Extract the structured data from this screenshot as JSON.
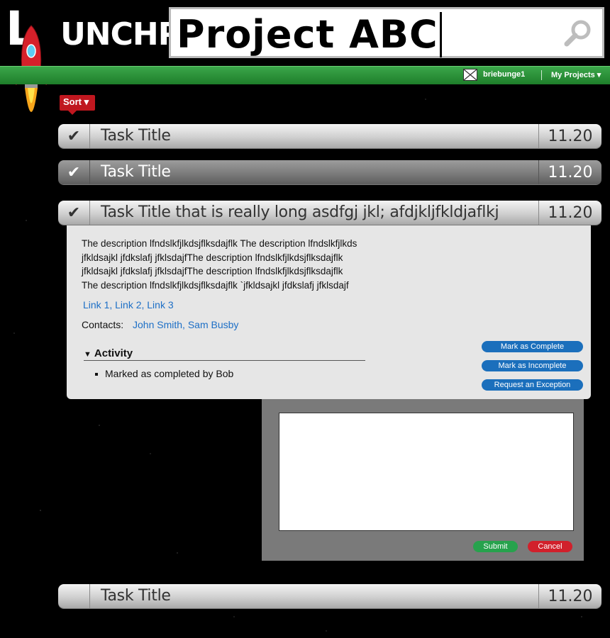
{
  "header": {
    "logo_initial": "L",
    "logo_rest": "UNCHPAD",
    "search_value": "Project ABC",
    "username": "briebunge1",
    "my_projects": "My Projects ▾",
    "accent_green": "#2a9a3a"
  },
  "sort": {
    "label": "Sort ▾"
  },
  "tasks": [
    {
      "title": "Task Title",
      "date": "11.20",
      "state": "light"
    },
    {
      "title": "Task Title",
      "date": "11.20",
      "state": "dark"
    },
    {
      "title": "Task Title that is really long asdfgj jkl; afdjkljfkldjaflkj",
      "date": "11.20",
      "state": "light",
      "expanded": true
    },
    {
      "title": "Task Title",
      "date": "11.20",
      "state": "light"
    }
  ],
  "detail": {
    "description_lines": [
      "The description lfndslkfjlkdsjflksdajflk The description lfndslkfjlkds",
      "jfkldsajkl jfdkslafj jfklsdajfThe description lfndslkfjlkdsjflksdajflk",
      "jfkldsajkl jfdkslafj jfklsdajfThe description lfndslkfjlkdsjflksdajflk",
      "The description lfndslkfjlkdsjflksdajflk `jfkldsajkl jfdkslafj jfklsdajf"
    ],
    "links": "Link 1, Link 2, Link 3",
    "contacts_label": "Contacts:",
    "contacts": "John Smith, Sam Busby",
    "activity_title": "Activity",
    "activity_items": [
      "Marked as completed by Bob"
    ],
    "buttons": {
      "complete": "Mark as Complete",
      "incomplete": "Mark as Incomplete",
      "exception": "Request an Exception"
    }
  },
  "comment": {
    "textarea_value": "",
    "submit": "Submit",
    "cancel": "Cancel"
  }
}
